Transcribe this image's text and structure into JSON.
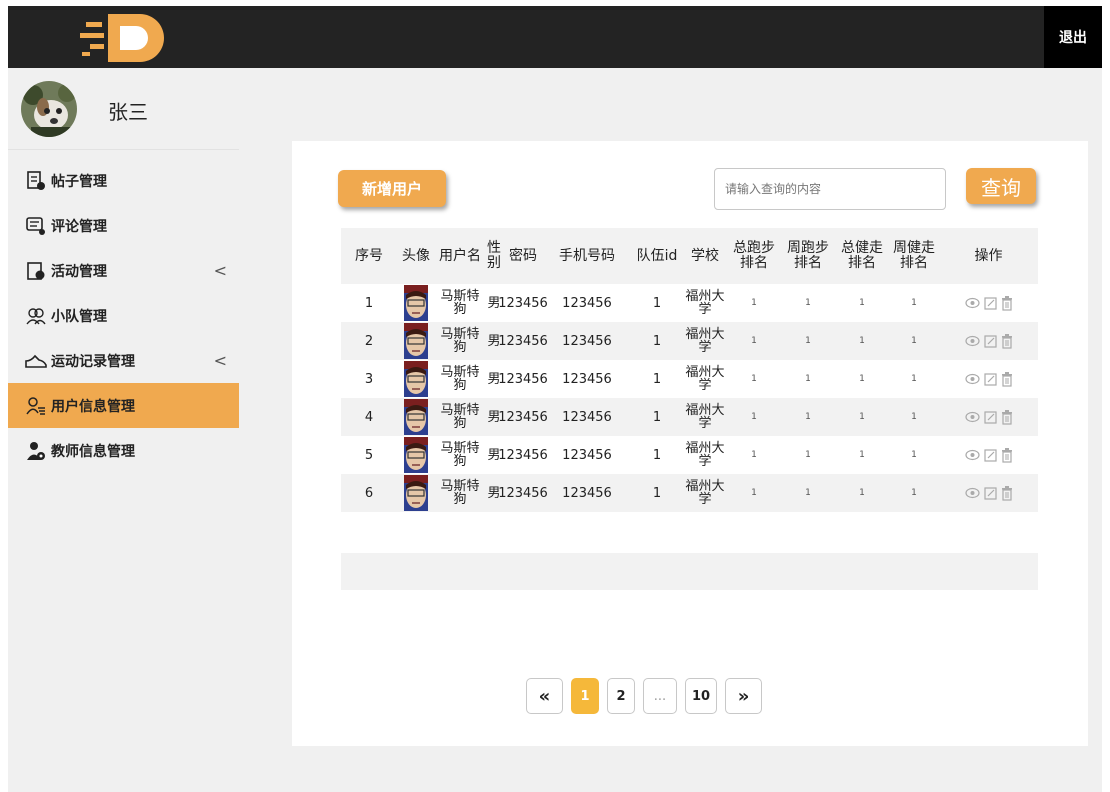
{
  "header": {
    "logout_label": "退出"
  },
  "sidebar": {
    "username": "张三",
    "items": [
      {
        "label": "帖子管理",
        "icon": "post-icon",
        "has_chevron": false,
        "active": false
      },
      {
        "label": "评论管理",
        "icon": "comment-icon",
        "has_chevron": false,
        "active": false
      },
      {
        "label": "活动管理",
        "icon": "activity-icon",
        "has_chevron": true,
        "active": false
      },
      {
        "label": "小队管理",
        "icon": "group-icon",
        "has_chevron": false,
        "active": false
      },
      {
        "label": "运动记录管理",
        "icon": "shoe-icon",
        "has_chevron": true,
        "active": false
      },
      {
        "label": "用户信息管理",
        "icon": "user-list-icon",
        "has_chevron": false,
        "active": true
      },
      {
        "label": "教师信息管理",
        "icon": "teacher-icon",
        "has_chevron": false,
        "active": false
      }
    ],
    "chevron": "<"
  },
  "toolbar": {
    "add_user_label": "新增用户",
    "search_placeholder": "请输入查询的内容",
    "query_label": "查询"
  },
  "table": {
    "headers": {
      "id": "序号",
      "avatar": "头像",
      "username": "用户名",
      "sex": "性别",
      "password": "密码",
      "phone": "手机号码",
      "team": "队伍id",
      "school": "学校",
      "rank1": "总跑步排名",
      "rank2": "周跑步排名",
      "rank3": "总健走排名",
      "rank4": "周健走排名",
      "ops": "操作"
    },
    "rows": [
      {
        "id": "1",
        "name": "马斯特狗",
        "sex": "男",
        "password": "123456",
        "phone": "123456",
        "team": "1",
        "school": "福州大学",
        "r1": "1",
        "r2": "1",
        "r3": "1",
        "r4": "1"
      },
      {
        "id": "2",
        "name": "马斯特狗",
        "sex": "男",
        "password": "123456",
        "phone": "123456",
        "team": "1",
        "school": "福州大学",
        "r1": "1",
        "r2": "1",
        "r3": "1",
        "r4": "1"
      },
      {
        "id": "3",
        "name": "马斯特狗",
        "sex": "男",
        "password": "123456",
        "phone": "123456",
        "team": "1",
        "school": "福州大学",
        "r1": "1",
        "r2": "1",
        "r3": "1",
        "r4": "1"
      },
      {
        "id": "4",
        "name": "马斯特狗",
        "sex": "男",
        "password": "123456",
        "phone": "123456",
        "team": "1",
        "school": "福州大学",
        "r1": "1",
        "r2": "1",
        "r3": "1",
        "r4": "1"
      },
      {
        "id": "5",
        "name": "马斯特狗",
        "sex": "男",
        "password": "123456",
        "phone": "123456",
        "team": "1",
        "school": "福州大学",
        "r1": "1",
        "r2": "1",
        "r3": "1",
        "r4": "1"
      },
      {
        "id": "6",
        "name": "马斯特狗",
        "sex": "男",
        "password": "123456",
        "phone": "123456",
        "team": "1",
        "school": "福州大学",
        "r1": "1",
        "r2": "1",
        "r3": "1",
        "r4": "1"
      }
    ]
  },
  "pagination": {
    "prev": "«",
    "pages": [
      "1",
      "2",
      "...",
      "10"
    ],
    "current": "1",
    "next": "»"
  },
  "colors": {
    "accent": "#f0a94f",
    "topbar": "#232323",
    "sidebar_bg": "#f0f0f0",
    "active_page": "#f5b83a"
  }
}
